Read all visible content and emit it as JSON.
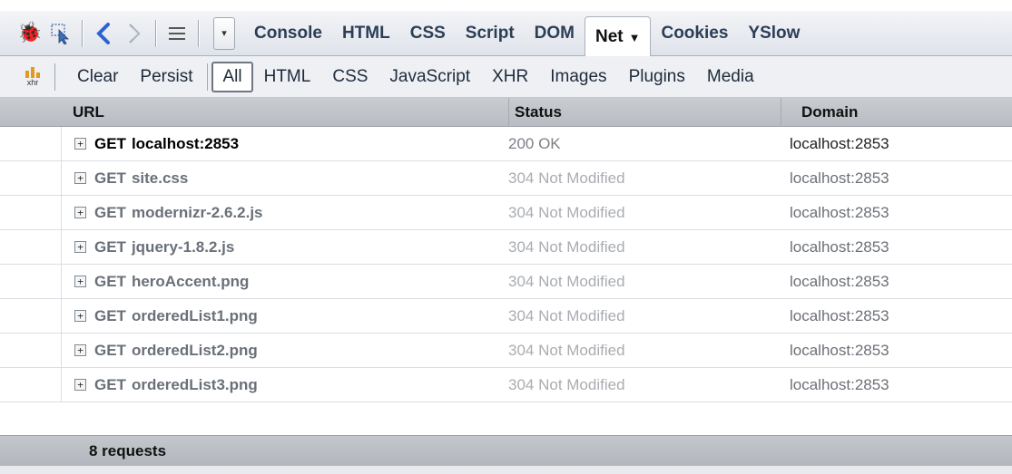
{
  "toolbar": {
    "icons": [
      "firebug-icon",
      "inspect-icon",
      "back-icon",
      "forward-icon",
      "list-icon"
    ],
    "tabs": [
      {
        "label": "Console"
      },
      {
        "label": "HTML"
      },
      {
        "label": "CSS"
      },
      {
        "label": "Script"
      },
      {
        "label": "DOM"
      },
      {
        "label": "Net",
        "active": true
      },
      {
        "label": "Cookies"
      },
      {
        "label": "YSlow"
      }
    ]
  },
  "net_toolbar": {
    "xhr_icon_label": "xhr",
    "clear_label": "Clear",
    "persist_label": "Persist",
    "filters": [
      {
        "label": "All",
        "active": true
      },
      {
        "label": "HTML"
      },
      {
        "label": "CSS"
      },
      {
        "label": "JavaScript"
      },
      {
        "label": "XHR"
      },
      {
        "label": "Images"
      },
      {
        "label": "Plugins"
      },
      {
        "label": "Media"
      }
    ]
  },
  "table": {
    "headers": {
      "url": "URL",
      "status": "Status",
      "domain": "Domain"
    },
    "rows": [
      {
        "method": "GET",
        "url": "localhost:2853",
        "status": "200 OK",
        "domain": "localhost:2853"
      },
      {
        "method": "GET",
        "url": "site.css",
        "status": "304 Not Modified",
        "domain": "localhost:2853"
      },
      {
        "method": "GET",
        "url": "modernizr-2.6.2.js",
        "status": "304 Not Modified",
        "domain": "localhost:2853"
      },
      {
        "method": "GET",
        "url": "jquery-1.8.2.js",
        "status": "304 Not Modified",
        "domain": "localhost:2853"
      },
      {
        "method": "GET",
        "url": "heroAccent.png",
        "status": "304 Not Modified",
        "domain": "localhost:2853"
      },
      {
        "method": "GET",
        "url": "orderedList1.png",
        "status": "304 Not Modified",
        "domain": "localhost:2853"
      },
      {
        "method": "GET",
        "url": "orderedList2.png",
        "status": "304 Not Modified",
        "domain": "localhost:2853"
      },
      {
        "method": "GET",
        "url": "orderedList3.png",
        "status": "304 Not Modified",
        "domain": "localhost:2853"
      }
    ],
    "summary": "8 requests"
  },
  "colors": {
    "toolbar_bg": "#dfe3ea",
    "header_bg": "#c9ccd1",
    "accent_blue": "#2c63d0"
  }
}
